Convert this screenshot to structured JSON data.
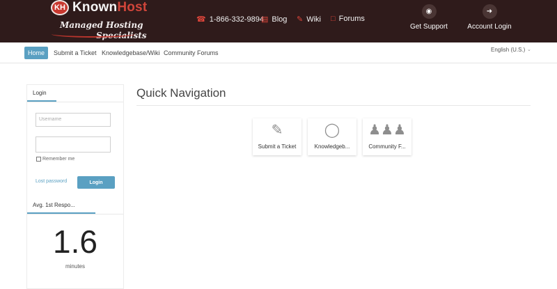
{
  "header": {
    "logo_badge": "KH",
    "logo_known": "Known",
    "logo_host": "Host",
    "tagline_line1": "Managed Hosting",
    "tagline_line2": "Specialists",
    "phone": "1-866-332-9894",
    "blog": "Blog",
    "wiki": "Wiki",
    "forums": "Forums",
    "get_support": "Get Support",
    "account_login": "Account Login"
  },
  "subnav": {
    "items": [
      {
        "label": "Home",
        "active": true
      },
      {
        "label": "Submit a Ticket",
        "active": false
      },
      {
        "label": "Knowledgebase/Wiki",
        "active": false
      },
      {
        "label": "Community Forums",
        "active": false
      }
    ],
    "language": "English (U.S.)"
  },
  "login_panel": {
    "tab": "Login",
    "username_placeholder": "Username",
    "password_placeholder": "",
    "remember_me": "Remember me",
    "lost_password": "Lost password",
    "login_button": "Login"
  },
  "stats_panel": {
    "tab": "Avg. 1st Respo...",
    "value": "1.6",
    "unit": "minutes"
  },
  "main": {
    "title": "Quick Navigation",
    "tiles": [
      {
        "label": "Submit a Ticket",
        "icon": "edit-icon"
      },
      {
        "label": "Knowledgeb...",
        "icon": "lightbulb-icon"
      },
      {
        "label": "Community F...",
        "icon": "community-icon"
      }
    ]
  },
  "colors": {
    "header_bg": "#2f1b1b",
    "accent_red": "#d0453a",
    "accent_blue": "#5aa0c2"
  }
}
